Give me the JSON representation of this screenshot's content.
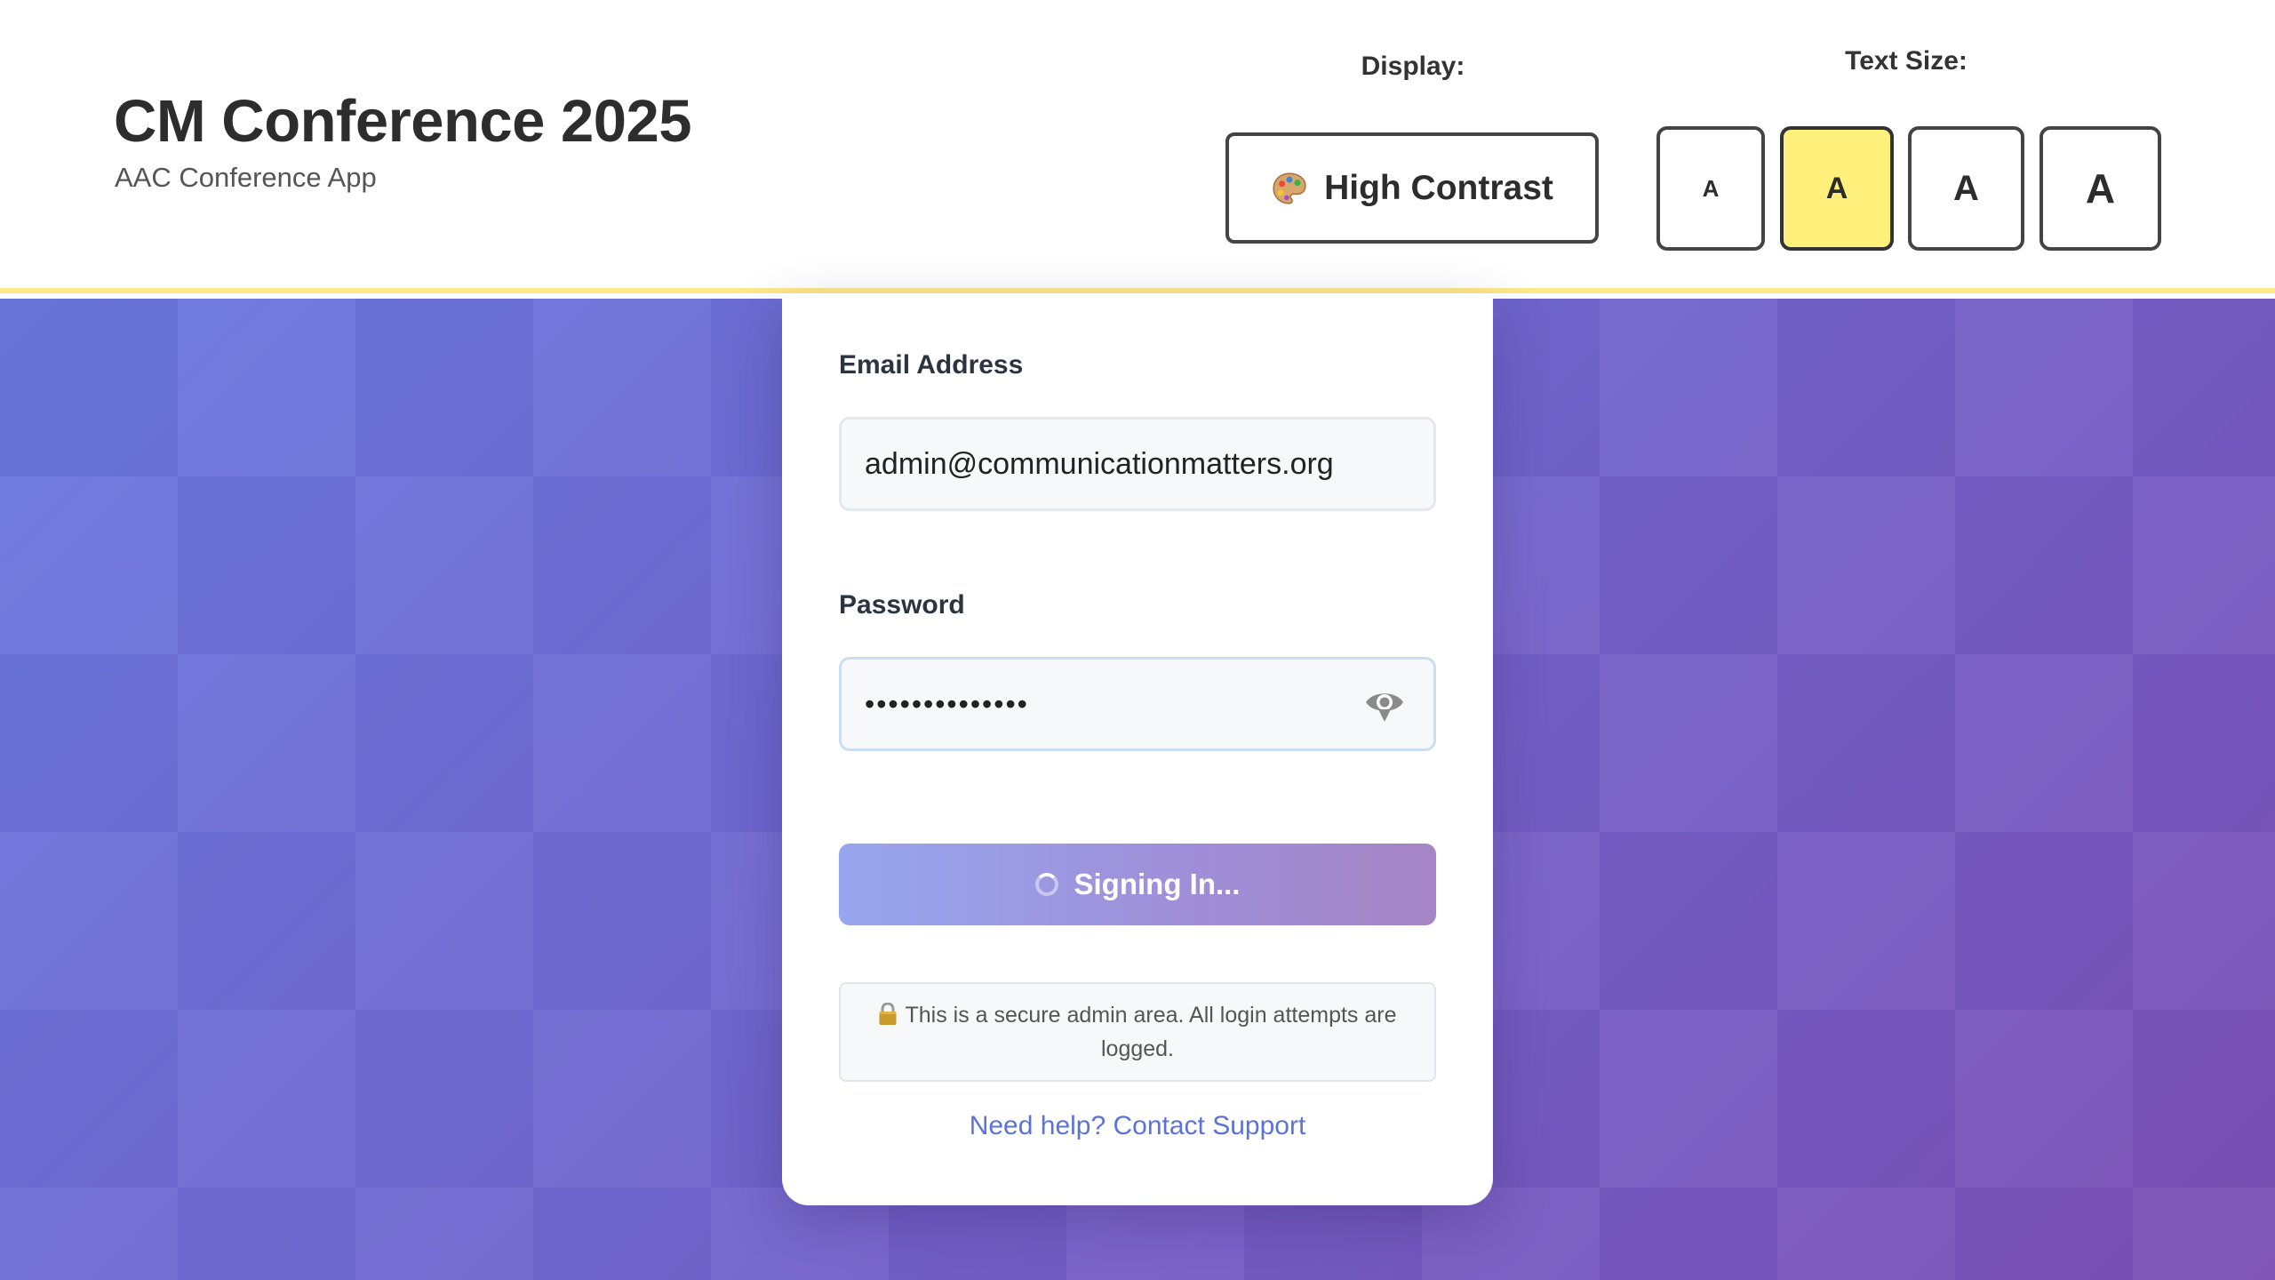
{
  "header": {
    "title": "CM Conference 2025",
    "subtitle": "AAC Conference App",
    "display_label": "Display:",
    "contrast_button_label": "High Contrast",
    "contrast_icon": "palette-icon",
    "text_size_label": "Text Size:",
    "text_size_options": [
      "A",
      "A",
      "A",
      "A"
    ],
    "text_size_selected_index": 1
  },
  "login": {
    "email_label": "Email Address",
    "email_value": "admin@communicationmatters.org",
    "password_label": "Password",
    "password_value": "••••••••••••••",
    "password_toggle_icon": "eye-icon",
    "submit_label": "Signing In...",
    "submit_state": "loading",
    "security_icon": "lock-icon",
    "security_notice": "This is a secure admin area. All login attempts are logged.",
    "help_link": "Need help? Contact Support"
  },
  "colors": {
    "accent_yellow": "#fef07a",
    "link_blue": "#5b73d9",
    "background_start": "#6a77dd",
    "background_end": "#7a4fb4"
  }
}
